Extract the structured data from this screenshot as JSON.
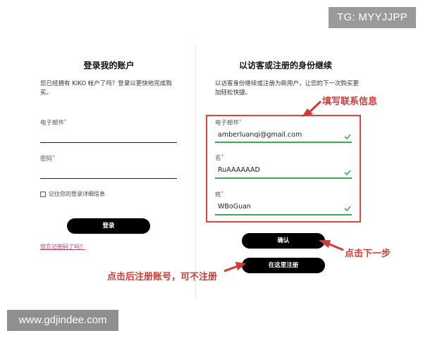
{
  "watermarks": {
    "tg": "TG: MYYJJPP",
    "site": "www.gdjindee.com"
  },
  "login": {
    "title": "登录我的账户",
    "description": "您已经拥有 KIKO 帐户了吗？登录以更快地完成购买。",
    "email_label": "电子邮件",
    "password_label": "密码",
    "required_mark": "*",
    "remember_label": "记住您的登录详细信息",
    "login_button": "登录",
    "forgot_link": "您忘记密码了吗？"
  },
  "guest": {
    "title": "以访客或注册的身份继续",
    "description": "以访客身份继续或注册为新用户，让您的下一次购买更加轻松快捷。",
    "required_mark": "*",
    "fields": [
      {
        "label": "电子邮件",
        "value": "amberluanqi@gmail.com"
      },
      {
        "label": "名",
        "value": "RuAAAAAAD"
      },
      {
        "label": "姓",
        "value": "WBoGuan"
      }
    ],
    "confirm_button": "确认",
    "register_button": "在这里注册"
  },
  "annotations": {
    "fill_contact": "填写联系信息",
    "click_next": "点击下一步",
    "register_note": "点击后注册账号，可不注册"
  },
  "colors": {
    "annotation": "#d23a33",
    "valid": "#3aa95a",
    "button": "#000000"
  }
}
